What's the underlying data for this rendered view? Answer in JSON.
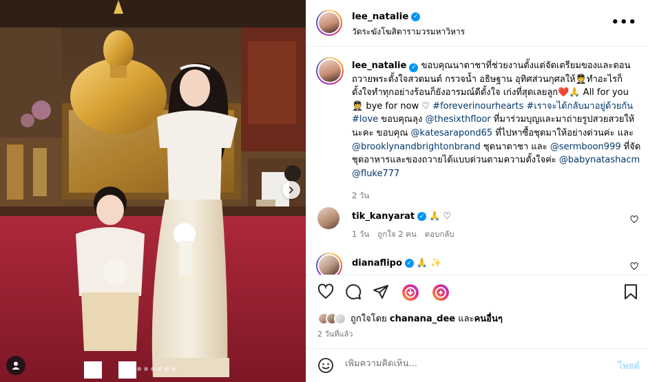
{
  "post": {
    "username": "lee_natalie",
    "location": "วัดระฆังโฆสิตารามวรมหาวิหาร",
    "more_label": "•••"
  },
  "caption": {
    "username": "lee_natalie",
    "seg1": "ขอบคุณนาตาชาที่ช่วยงานตั้งแต่จัดเตรียมของและตอนถวายพระตั้งใจสวดมนต์ กรวจน้ำ อธิษฐาน อุทิศส่วนกุศลให้",
    "seg2": "ทำอะไรก็ตั้งใจทำทุกอย่างร้อนก็ยังอารมณ์ดีตั้งใจ เก่งที่สุดเลยลูก",
    "seg3": " All for you ",
    "seg4": " bye for now ",
    "tag1": "#foreverinourhearts",
    "tag2": "#เราจะได้กลับมาอยู่ด้วยกัน",
    "tag3": "#love",
    "seg5": " ขอบคุณลุง ",
    "m1": "@thesixthfloor",
    "seg6": " ที่มาร่วมบุญและมาถ่ายรูปสวยสวยให้นะคะ ขอบคุณ ",
    "m2": "@katesarapond65",
    "seg7": " ที่ไปหาซื้อชุดมาให้อย่างด่วนค่ะ และ ",
    "m3": "@brooklynandbrightonbrand",
    "seg8": " ชุดนาตาชา และ ",
    "m4": "@sermboon999",
    "seg9": " ที่จัดชุดอาหารและของถวายได้แบบด่วนตามความตั้งใจค่ะ ",
    "m5": "@babynatashacm",
    "m6": "@fluke777",
    "time": "2 วัน"
  },
  "comments": [
    {
      "username": "tik_kanyarat",
      "text": "🙏 ♡",
      "time": "1 วัน",
      "likes": "ถูกใจ 2 คน",
      "reply": "ตอบกลับ"
    },
    {
      "username": "dianaflipo",
      "text": "🙏 ✨"
    }
  ],
  "likes": {
    "prefix": "ถูกใจโดย ",
    "user": "chanana_dee",
    "middle": " และ",
    "others": "คนอื่นๆ"
  },
  "post_time": "2 วันที่แล้ว",
  "comment_box": {
    "placeholder": "เพิ่มความคิดเห็น...",
    "post_label": "โพสต์"
  },
  "carousel": {
    "count": 7,
    "active": 0
  },
  "colors": {
    "verified": "#0095f6",
    "link": "#00376b",
    "muted": "#737373",
    "post_disabled": "#b2dffc"
  }
}
